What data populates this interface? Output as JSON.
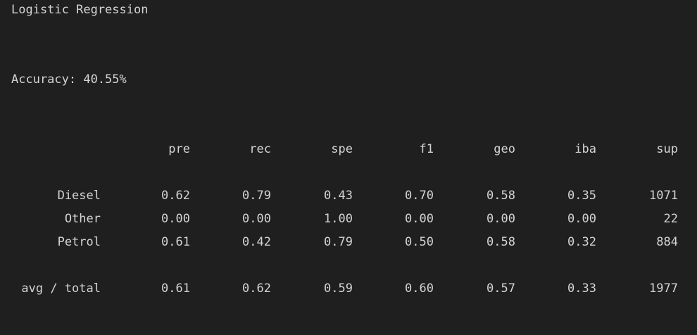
{
  "title": "Logistic Regression",
  "accuracy_label": "Accuracy: 40.55%",
  "report": {
    "headers": [
      "pre",
      "rec",
      "spe",
      "f1",
      "geo",
      "iba",
      "sup"
    ],
    "rows": [
      {
        "label": "Diesel",
        "values": [
          "0.62",
          "0.79",
          "0.43",
          "0.70",
          "0.58",
          "0.35",
          "1071"
        ]
      },
      {
        "label": "Other",
        "values": [
          "0.00",
          "0.00",
          "1.00",
          "0.00",
          "0.00",
          "0.00",
          "22"
        ]
      },
      {
        "label": "Petrol",
        "values": [
          "0.61",
          "0.42",
          "0.79",
          "0.50",
          "0.58",
          "0.32",
          "884"
        ]
      }
    ],
    "total": {
      "label": "avg / total",
      "values": [
        "0.61",
        "0.62",
        "0.59",
        "0.60",
        "0.57",
        "0.33",
        "1977"
      ]
    }
  }
}
